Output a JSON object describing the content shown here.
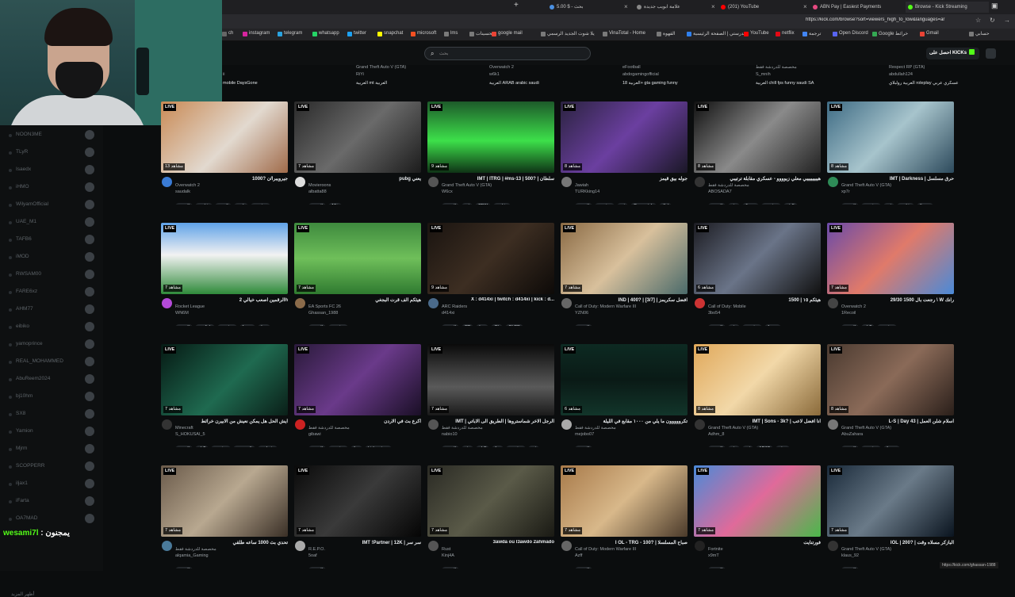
{
  "browser": {
    "tabs": [
      {
        "label": "5.00 $ - بحث",
        "color": "#4a90e2"
      },
      {
        "label": "علامة ابويب جديدة",
        "color": "#888888"
      },
      {
        "label": "(201) YouTube",
        "color": "#ff0000"
      },
      {
        "label": "ABN Pay | Easiest Payments",
        "color": "#e64980"
      },
      {
        "label": "Browse - Kick Streaming",
        "color": "#53fc18"
      }
    ],
    "url": "https://kick.com/browse?sort=viewers_high_to_low&languages=ar",
    "bookmarks": [
      {
        "label": "ch",
        "color": "#666666"
      },
      {
        "label": "instagram",
        "color": "#d6249f"
      },
      {
        "label": "telegram",
        "color": "#2aa3e0"
      },
      {
        "label": "whatsapp",
        "color": "#25d366"
      },
      {
        "label": "twitter",
        "color": "#1da1f2"
      },
      {
        "label": "snapchat",
        "color": "#fffc00"
      },
      {
        "label": "microsoft",
        "color": "#f25022"
      },
      {
        "label": "lms",
        "color": "#7a7a7a"
      },
      {
        "label": "تحسينات",
        "color": "#7a7a7a"
      },
      {
        "label": "google mail",
        "color": "#ea4335"
      },
      {
        "label": "يلا شوت الجديد الرسمي",
        "color": "#7a7a7a"
      },
      {
        "label": "VinaTotal - Home",
        "color": "#7a7a7a"
      },
      {
        "label": "القهوة",
        "color": "#7a7a7a"
      },
      {
        "label": "مدرستي | الصفحة الرئيسية",
        "color": "#2f80ed"
      },
      {
        "label": "YouTube",
        "color": "#ff0000"
      },
      {
        "label": "netflix",
        "color": "#e50914"
      },
      {
        "label": "ترجمة",
        "color": "#4285f4"
      },
      {
        "label": "Open Discord",
        "color": "#5865f2"
      },
      {
        "label": "Google خرائط",
        "color": "#34a853"
      },
      {
        "label": "Gmail",
        "color": "#ea4335"
      },
      {
        "label": "حسابي",
        "color": "#7a7a7a"
      }
    ]
  },
  "header": {
    "search_placeholder": "بحث",
    "get_kicks": "احصل على KICKs"
  },
  "sidebar": {
    "items": [
      "NOON3ME",
      "TLyR",
      "Isaedx",
      "iHMO",
      "WilyamOfficial",
      "UAE_M1",
      "TAFB6",
      "iMOD",
      "RWSAM00",
      "FARE6xz",
      "AHM77",
      "eibiko",
      "yamoprince",
      "REAL_MOHAMMED",
      "AbuReem2024",
      "bj10hm",
      "SX8",
      "Yamion",
      "Mjrm",
      "SCOPPERR",
      "iljax1",
      "iFarta",
      "OA7MAD"
    ],
    "footer": "أظهر المزيد"
  },
  "chat_overlay": {
    "user": "wesami7l",
    "sep": " : ",
    "text": "يمجنون"
  },
  "status_url": "https://kick.com/ghassan-1988",
  "top_row": [
    {
      "tags": "mobile  DaysGone",
      "category": "",
      "streamer": "ii"
    },
    {
      "tags": "العربية  mt  العربية",
      "category": "Grand Theft Auto V (GTA)",
      "streamer": "RiYi"
    },
    {
      "tags": "العربية  ARAB  arabic  saudi",
      "category": "Overwatch 2",
      "streamer": "w6k1"
    },
    {
      "tags": "العربية  18+  gta  gaming  funny",
      "category": "eFootball",
      "streamer": "abdogamingofficial"
    },
    {
      "tags": "العربية  chill  fps  funny  saudi  SA",
      "category": "مخصصة للدردشة فقط",
      "streamer": "S_mnih"
    },
    {
      "tags": "العربية  رولبلاي  roleplay  عسكري  عربي",
      "category": "Respect RP (GTA)",
      "streamer": "abdullah124"
    }
  ],
  "streams": [
    {
      "title": "1000? جيرويبرا/ن",
      "category": "Overwatch 2",
      "streamer": "saudalk",
      "viewers": "13 مشاهد",
      "tags": [
        "العربية",
        "arabic",
        "saudi",
        "rank",
        "gaming"
      ],
      "bg": "linear-gradient(135deg,#c98a55,#e2d9cf 55%,#a06b4a)",
      "av": "#3a7bd5"
    },
    {
      "title": "pubg يعني",
      "category": "Movieroons",
      "streamer": "albatta88",
      "viewers": "7 مشاهد",
      "tags": [
        "العربية",
        "18+"
      ],
      "bg": "linear-gradient(135deg,#2a2a2a,#6a6a6a 50%,#1c1c1c)",
      "av": "#dddddd"
    },
    {
      "title": "IMT | ITRG | #ms-13 | 500? | سلطان",
      "category": "Grand Theft Auto V (GTA)",
      "streamer": "W6cx",
      "viewers": "9 مشاهد",
      "tags": [
        "العربية",
        "mt",
        "CFW",
        "arabic"
      ],
      "bg": "linear-gradient(180deg,#1d5a2a,#3de04a 55%,#0f3316)",
      "av": "#555555"
    },
    {
      "title": "جوله بيق قيمز",
      "category": "Jawiah",
      "streamer": "TURKking14",
      "viewers": "8 مشاهد",
      "tags": [
        "العربية",
        "gaming",
        "mt",
        "Overwatch",
        "dbd"
      ],
      "bg": "linear-gradient(135deg,#2b2340,#6b3fa0 50%,#1a1726)",
      "av": "#777777"
    },
    {
      "title": "هييييييييي معلي زيوووو - عسكري مقابلة ترتيبي",
      "category": "مخصصة للدردشة فقط",
      "streamer": "ABOSADA7",
      "viewers": "8 مشاهد",
      "tags": [
        "العربية",
        "gta",
        "fivem",
        "gaming",
        "gta5"
      ],
      "bg": "linear-gradient(135deg,#111,#8a8a8a 50%,#222)",
      "av": "#333333"
    },
    {
      "title": "IMT | Darkness | حرق مسلسل",
      "category": "Grand Theft Auto V (GTA)",
      "streamer": "xp7r",
      "viewers": "8 مشاهد",
      "tags": [
        "العربية",
        "gaming",
        "mt",
        "arabic",
        "fivem"
      ],
      "bg": "linear-gradient(135deg,#3e6b84,#a7c4cc 50%,#2d4a5c)",
      "av": "#2e8b57"
    },
    {
      "title": "الرقمين اصعب خيالي 2h",
      "category": "Rocket League",
      "streamer": "WN6M",
      "viewers": "7 مشاهد",
      "tags": [
        "العربية",
        "english",
        "gaming",
        "funny",
        "ksa"
      ],
      "bg": "linear-gradient(180deg,#5fa2e8,#f2f2f2 45%,#2f8a3a)",
      "av": "#b44ad8"
    },
    {
      "title": "هيئكم الف قرت البجغي",
      "category": "EA Sports FC 26",
      "streamer": "Ghassan_1988",
      "viewers": "7 مشاهد",
      "tags": [
        "العربية",
        "gaming"
      ],
      "bg": "linear-gradient(180deg,#3e8a3e,#6fbf5a 50%,#2f7a30)",
      "av": "#8b6b4a"
    },
    {
      "title": "X : d414xi | twitch : d414xi | kick : d...",
      "category": "ARC Raiders",
      "streamer": "d414xi",
      "viewers": "9 مشاهد",
      "tags": [
        "العربية",
        "RP",
        "ksa",
        "OL",
        "OLRD"
      ],
      "bg": "linear-gradient(135deg,#1a1410,#3d2e22 50%,#0d0a08)",
      "av": "#4a6a8a"
    },
    {
      "title": "IND | 400? | [3/7] | افضل سكريمز",
      "category": "Call of Duty: Modern Warfare III",
      "streamer": "YZN06",
      "viewers": "7 مشاهد",
      "tags": [
        "العربية"
      ],
      "bg": "linear-gradient(135deg,#8a6a44,#d8c09c 50%,#4a6a6a)",
      "av": "#666666"
    },
    {
      "title": "هيئكم ١٥ | 1500",
      "category": "Call of Duty: Mobile",
      "streamer": "3bo54",
      "viewers": "6 مشاهد",
      "tags": [
        "العربية",
        "gta",
        "gaming",
        "funny"
      ],
      "bg": "linear-gradient(135deg,#1c1c22,#6a7488 50%,#111)",
      "av": "#cc3333"
    },
    {
      "title": "29/30 رجعت بال 1500 \\ W رانك",
      "category": "Overwatch 2",
      "streamer": "1Recoil",
      "viewers": "7 مشاهد",
      "tags": [
        "العربية",
        "chill",
        "gaming"
      ],
      "bg": "linear-gradient(135deg,#6a4aa8,#e07a6a 50%,#4a8ad8)",
      "av": "#444444"
    },
    {
      "title": "ايش الحل هل يمكن نعيش من الابيرن خرائط",
      "category": "Minecraft",
      "streamer": "S_HOKUSAI_5",
      "viewers": "7 مشاهد",
      "tags": [
        "العربية",
        "chill",
        "gaming",
        "السعودية",
        "arabaic"
      ],
      "bg": "linear-gradient(135deg,#061a14,#1f6a50 55%,#0a1f18)",
      "av": "#333333"
    },
    {
      "title": "اكرع بث في الاردن",
      "category": "مخصصة للدردشة فقط",
      "streamer": "gibawi",
      "viewers": "7 مشاهد",
      "tags": [
        "العربية",
        "gaming",
        "fyp",
        "kickpartner"
      ],
      "bg": "linear-gradient(135deg,#2a1a3a,#6a3a8a 50%,#1a0f26)",
      "av": "#cc2222"
    },
    {
      "title": "IMT | الرجل الاخر شماستروها | الطريق الى الاباتي",
      "category": "مخصصة للدردشة فقط",
      "streamer": "nabio10",
      "viewers": "7 مشاهد",
      "tags": [
        "العربية",
        "gta",
        "chill",
        "fps",
        "gaming",
        "mt"
      ],
      "bg": "linear-gradient(180deg,#0a0a0a,#5a5a5a 60%,#1a1a1a)",
      "av": "#555555"
    },
    {
      "title": "تكرووووون ما يلي من ١٠٠٠ مقابع في الليلة",
      "category": "مخصصة للدردشة فقط",
      "streamer": "mejobo07",
      "viewers": "6 مشاهد",
      "tags": [
        "العربية"
      ],
      "bg": "linear-gradient(180deg,#0d2a22,#0a1a16 50%,#12352a)",
      "av": "#aaaaaa"
    },
    {
      "title": "IMT | Sons - 3k? | انا افضل لاعب",
      "category": "Grand Theft Auto V (GTA)",
      "streamer": "Adhm_8",
      "viewers": "8 مشاهد",
      "tags": [
        "العربية",
        "gta",
        "mt",
        "ARAB",
        "gtav"
      ],
      "bg": "linear-gradient(135deg,#e0a85a,#f2d8a8 50%,#8a6a3a)",
      "av": "#333333"
    },
    {
      "title": "L-S | Day 43 | اسلام شلن العمل",
      "category": "Grand Theft Auto V (GTA)",
      "streamer": "AbuZahara",
      "viewers": "8 مشاهد",
      "tags": [
        "العربية",
        "gaming",
        "funny"
      ],
      "bg": "linear-gradient(135deg,#4a3a30,#8a6a58 50%,#2a1f1a)",
      "av": "#777777"
    },
    {
      "title": "تحدي بث 1000 ساعه طلقي",
      "category": "مخصصة للدردشة فقط",
      "streamer": "alqamia_Gaming",
      "viewers": "7 مشاهد",
      "tags": [
        "العربية"
      ],
      "bg": "linear-gradient(135deg,#6a5a4a,#b8a890 50%,#3a2f26)",
      "av": "#4a7a9a"
    },
    {
      "title": "IMT !Partner | 12K | سر سر",
      "category": "R.E.P.O.",
      "streamer": "5oaf",
      "viewers": "7 مشاهد",
      "tags": [
        "العربية"
      ],
      "bg": "linear-gradient(135deg,#0a0a0a,#3a3a3a 50%,#050505)",
      "av": "#aaaaaa"
    },
    {
      "title": "3awda ou l3awdo 2ahmado",
      "category": "Rust",
      "streamer": "Kinj4A",
      "viewers": "7 مشاهد",
      "tags": [
        "العربية"
      ],
      "bg": "linear-gradient(135deg,#2a2a24,#5a5a48 50%,#1a1a14)",
      "av": "#555555"
    },
    {
      "title": "I OL - TRG - 100? | صباح المسلسلا",
      "category": "Call of Duty: Modern Warfare III",
      "streamer": "Azff",
      "viewers": "7 مشاهد",
      "tags": [
        "العربية"
      ],
      "bg": "linear-gradient(135deg,#a87a4a,#d8b88a 50%,#4a3a2a)",
      "av": "#666666"
    },
    {
      "title": "فورتنايت",
      "category": "Fortnite",
      "streamer": "x9mT",
      "viewers": "7 مشاهد",
      "tags": [
        "العربية"
      ],
      "bg": "linear-gradient(135deg,#4a8ad8,#e06a9a 50%,#4ab84a)",
      "av": "#222222"
    },
    {
      "title": "IOL | 200? | البازكر مسلاه وقت",
      "category": "Grand Theft Auto V (GTA)",
      "streamer": "klaus_92",
      "viewers": "7 مشاهد",
      "tags": [
        "العربية"
      ],
      "bg": "linear-gradient(135deg,#1a2a3a,#6a7a88 50%,#0a141f)",
      "av": "#333333"
    }
  ]
}
